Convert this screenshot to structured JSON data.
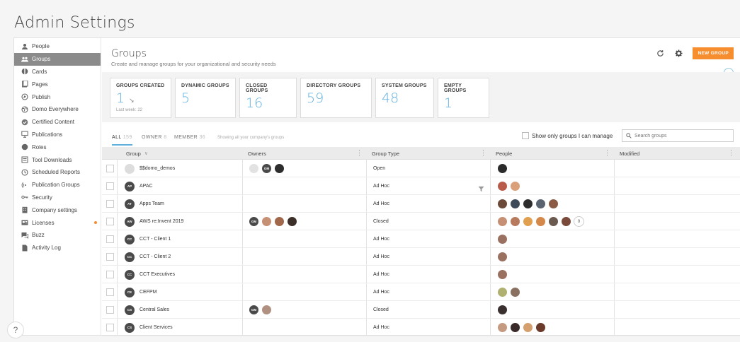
{
  "page_title": "Admin Settings",
  "sidebar": {
    "items": [
      {
        "label": "People",
        "icon": "person-icon",
        "active": false
      },
      {
        "label": "Groups",
        "icon": "groups-icon",
        "active": true
      },
      {
        "label": "Cards",
        "icon": "cards-icon",
        "active": false
      },
      {
        "label": "Pages",
        "icon": "pages-icon",
        "active": false
      },
      {
        "label": "Publish",
        "icon": "publish-icon",
        "active": false
      },
      {
        "label": "Domo Everywhere",
        "icon": "globe-icon",
        "active": false
      },
      {
        "label": "Certified Content",
        "icon": "certified-icon",
        "active": false
      },
      {
        "label": "Publications",
        "icon": "publications-icon",
        "active": false
      },
      {
        "label": "Roles",
        "icon": "roles-icon",
        "active": false
      },
      {
        "label": "Tool Downloads",
        "icon": "download-icon",
        "active": false
      },
      {
        "label": "Scheduled Reports",
        "icon": "clock-icon",
        "active": false
      },
      {
        "label": "Publication Groups",
        "icon": "broadcast-icon",
        "active": false
      },
      {
        "label": "Security",
        "icon": "key-icon",
        "active": false
      },
      {
        "label": "Company settings",
        "icon": "building-icon",
        "active": false
      },
      {
        "label": "Licenses",
        "icon": "license-icon",
        "active": false,
        "badge": true
      },
      {
        "label": "Buzz",
        "icon": "chat-icon",
        "active": false
      },
      {
        "label": "Activity Log",
        "icon": "log-icon",
        "active": false
      }
    ],
    "help_label": "?"
  },
  "main": {
    "title": "Groups",
    "subtitle": "Create and manage groups for your organizational and security needs",
    "new_button": "NEW GROUP",
    "accent_color": "#f68d2e",
    "value_color": "#62b0de"
  },
  "summary": [
    {
      "label": "GROUPS CREATED",
      "value": "1",
      "arrow": "↘",
      "sub": "Last week: 22"
    },
    {
      "label": "DYNAMIC GROUPS",
      "value": "5"
    },
    {
      "label": "CLOSED GROUPS",
      "value": "16"
    },
    {
      "label": "DIRECTORY GROUPS",
      "value": "59"
    },
    {
      "label": "SYSTEM GROUPS",
      "value": "48"
    },
    {
      "label": "EMPTY GROUPS",
      "value": "1"
    }
  ],
  "filters": {
    "tabs": [
      {
        "label": "ALL",
        "count": "159"
      },
      {
        "label": "OWNER",
        "count": "8"
      },
      {
        "label": "MEMBER",
        "count": "36"
      }
    ],
    "note": "Showing all your company's groups",
    "manage_label": "Show only groups I can manage",
    "search_placeholder": "Search groups"
  },
  "table": {
    "columns": [
      "Group",
      "Owners",
      "Group Type",
      "People",
      "Modified"
    ],
    "rows": [
      {
        "initials": "",
        "name": "$$domo_demos",
        "owners": [
          "ghost",
          "GM",
          "#2d2d2d"
        ],
        "type": "Open",
        "people": [
          "#2b2b2b"
        ],
        "extra": ""
      },
      {
        "initials": "AP",
        "name": "APAC",
        "owners": [],
        "type": "Ad Hoc",
        "people": [
          "#b85b4a",
          "#d9a07a"
        ],
        "extra": ""
      },
      {
        "initials": "AT",
        "name": "Apps Team",
        "owners": [],
        "type": "Ad Hoc",
        "people": [
          "#6b4a3a",
          "#3d4a5a",
          "#2c2c2c",
          "#5a6470",
          "#8a5a44"
        ],
        "extra": ""
      },
      {
        "initials": "AW",
        "name": "AWS re:Invent 2019",
        "owners": [
          "GM",
          "#c69074",
          "#a0674a",
          "#3c2f2a"
        ],
        "type": "Closed",
        "people": [
          "#c69074",
          "#b87a5e",
          "#e0a050",
          "#d4884a",
          "#6a5a50",
          "#7a4a3a"
        ],
        "extra": "9"
      },
      {
        "initials": "CC",
        "name": "CCT - Client 1",
        "owners": [],
        "type": "Ad Hoc",
        "people": [
          "#9a7060"
        ],
        "extra": ""
      },
      {
        "initials": "CC",
        "name": "CCT - Client 2",
        "owners": [],
        "type": "Ad Hoc",
        "people": [
          "#9a7060"
        ],
        "extra": ""
      },
      {
        "initials": "CC",
        "name": "CCT Executives",
        "owners": [],
        "type": "Ad Hoc",
        "people": [
          "#9a7060"
        ],
        "extra": ""
      },
      {
        "initials": "CE",
        "name": "CEFPM",
        "owners": [],
        "type": "Ad Hoc",
        "people": [
          "#b0b070",
          "#8a7060"
        ],
        "extra": ""
      },
      {
        "initials": "CS",
        "name": "Central Sales",
        "owners": [
          "GM",
          "#b09080"
        ],
        "type": "Closed",
        "people": [
          "#3a3030"
        ],
        "extra": ""
      },
      {
        "initials": "CS",
        "name": "Client Services",
        "owners": [],
        "type": "Ad Hoc",
        "people": [
          "#c49a80",
          "#3a2a2a",
          "#d4a070",
          "#6a3a2a"
        ],
        "extra": ""
      }
    ]
  }
}
